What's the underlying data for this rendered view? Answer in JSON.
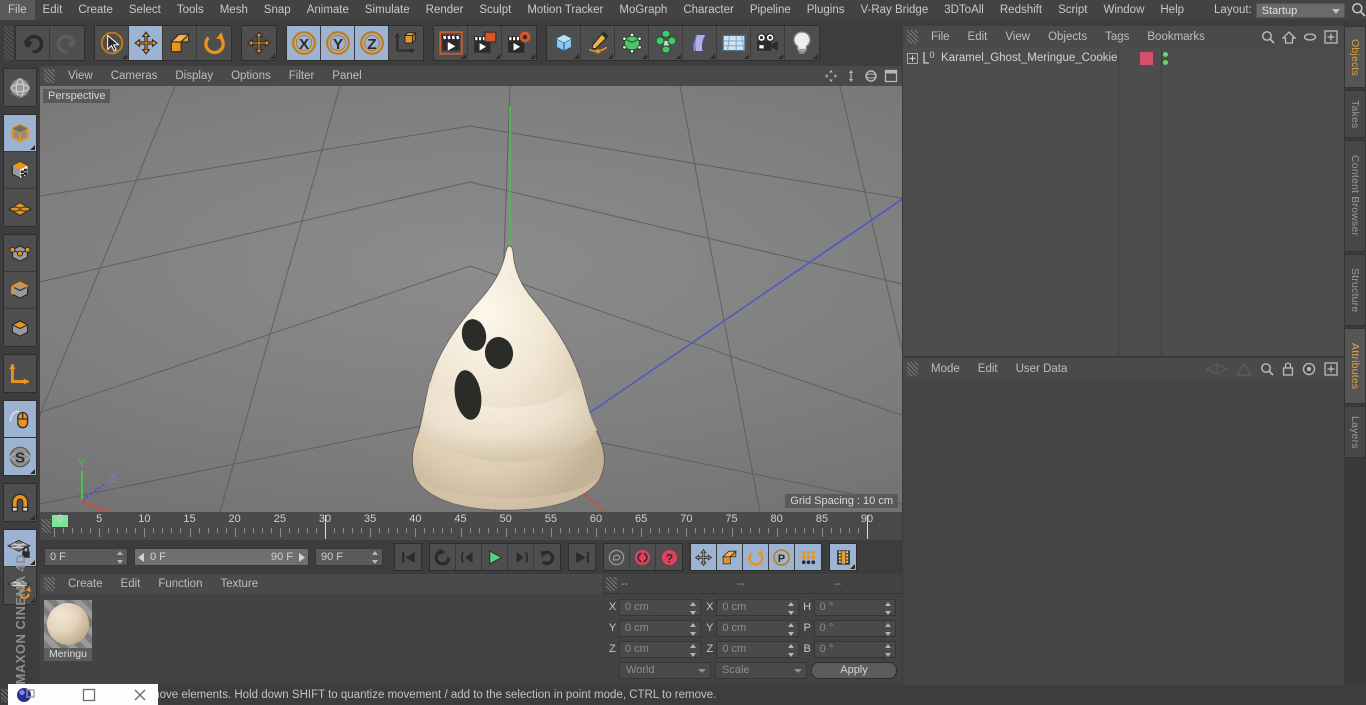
{
  "app": {
    "brand": "MAXON CINEMA 4D",
    "title": "CINEMA 4D"
  },
  "menubar": {
    "items": [
      "File",
      "Edit",
      "Create",
      "Select",
      "Tools",
      "Mesh",
      "Snap",
      "Animate",
      "Simulate",
      "Render",
      "Sculpt",
      "Motion Tracker",
      "MoGraph",
      "Character",
      "Pipeline",
      "Plugins",
      "V-Ray Bridge",
      "3DToAll",
      "Redshift",
      "Script",
      "Window",
      "Help"
    ],
    "layout_label": "Layout:",
    "layout_value": "Startup",
    "search_icon": "magnifier-icon"
  },
  "toolbar": {
    "groups": [
      {
        "name": "undo-redo",
        "buttons": [
          {
            "name": "undo-button",
            "icon": "undo-arrow-icon",
            "active": false,
            "enabled": true
          },
          {
            "name": "redo-button",
            "icon": "redo-arrow-icon",
            "active": false,
            "enabled": false
          }
        ]
      },
      {
        "name": "transform-tools",
        "buttons": [
          {
            "name": "live-selection-tool",
            "icon": "cursor-circle-icon",
            "active": false,
            "enabled": true
          },
          {
            "name": "move-tool",
            "icon": "move-arrows-icon",
            "active": true,
            "enabled": true
          },
          {
            "name": "scale-tool",
            "icon": "scale-box-icon",
            "active": false,
            "enabled": true
          },
          {
            "name": "rotate-tool",
            "icon": "rotate-arc-icon",
            "active": false,
            "enabled": true
          }
        ]
      },
      {
        "name": "move-duplicate",
        "buttons": [
          {
            "name": "move-secondary-tool",
            "icon": "move-arrows-icon",
            "active": false,
            "enabled": true
          }
        ]
      },
      {
        "name": "axis-locks",
        "buttons": [
          {
            "name": "lock-x-axis",
            "icon": "x-axis-icon",
            "label": "X",
            "active": true,
            "enabled": true
          },
          {
            "name": "lock-y-axis",
            "icon": "y-axis-icon",
            "label": "Y",
            "active": true,
            "enabled": true
          },
          {
            "name": "lock-z-axis",
            "icon": "z-axis-icon",
            "label": "Z",
            "active": true,
            "enabled": true
          },
          {
            "name": "world-object-coordinate-toggle",
            "icon": "world-axis-cube-icon",
            "active": false,
            "enabled": true
          }
        ]
      },
      {
        "name": "render-tools",
        "buttons": [
          {
            "name": "render-view-button",
            "icon": "clapperboard-icon",
            "active": false,
            "enabled": true
          },
          {
            "name": "render-to-picture-viewer-button",
            "icon": "clapperboard-window-icon",
            "active": false,
            "enabled": true
          },
          {
            "name": "render-settings-button",
            "icon": "clapperboard-gear-icon",
            "active": false,
            "enabled": true
          }
        ]
      },
      {
        "name": "object-creation",
        "buttons": [
          {
            "name": "add-primitive-cube-button",
            "icon": "blue-cube-icon",
            "active": false,
            "enabled": true
          },
          {
            "name": "add-spline-button",
            "icon": "pen-spline-icon",
            "active": false,
            "enabled": true
          },
          {
            "name": "add-generator-button",
            "icon": "green-cube-nurbs-icon",
            "active": false,
            "enabled": true
          },
          {
            "name": "add-mograph-button",
            "icon": "green-cluster-icon",
            "active": false,
            "enabled": true
          },
          {
            "name": "add-deformer-button",
            "icon": "purple-bend-icon",
            "active": false,
            "enabled": true
          },
          {
            "name": "add-scene-object-button",
            "icon": "floor-grid-icon",
            "active": false,
            "enabled": true
          },
          {
            "name": "add-camera-button",
            "icon": "camera-icon",
            "active": false,
            "enabled": true
          },
          {
            "name": "add-light-button",
            "icon": "lightbulb-icon",
            "active": false,
            "enabled": true
          }
        ]
      }
    ]
  },
  "left_toolbar": {
    "groups": [
      {
        "name": "undo-view-group",
        "buttons": [
          {
            "name": "undo-view-button",
            "icon": "globe-sphere-icon",
            "active": false
          }
        ]
      },
      {
        "name": "editor-modes-group",
        "buttons": [
          {
            "name": "make-editable-button",
            "icon": "orange-outline-cube-icon",
            "active": true
          },
          {
            "name": "texture-mode-button",
            "icon": "checker-cube-icon",
            "active": false
          },
          {
            "name": "viewport-solo-button",
            "icon": "orange-grid-plane-icon",
            "active": false
          }
        ]
      },
      {
        "name": "component-modes-group",
        "buttons": [
          {
            "name": "points-mode-button",
            "icon": "cube-points-icon",
            "active": false
          },
          {
            "name": "edges-mode-button",
            "icon": "cube-edges-icon",
            "active": false
          },
          {
            "name": "polygons-mode-button",
            "icon": "cube-polygons-icon",
            "active": false
          }
        ]
      },
      {
        "name": "axis-group",
        "buttons": [
          {
            "name": "enable-axis-modification-button",
            "icon": "axis-corner-icon",
            "active": false
          }
        ]
      },
      {
        "name": "tweak-group",
        "buttons": [
          {
            "name": "tweak-mode-button",
            "icon": "mouse-cursor-icon",
            "active": true
          },
          {
            "name": "soft-selection-button",
            "icon": "s-sphere-icon",
            "active": true
          }
        ]
      },
      {
        "name": "snap-group",
        "buttons": [
          {
            "name": "enable-snapping-button",
            "icon": "magnet-icon",
            "active": false
          }
        ]
      },
      {
        "name": "workplane-group",
        "buttons": [
          {
            "name": "lock-workplane-button",
            "icon": "grid-lock-icon",
            "active": true
          },
          {
            "name": "planar-workplane-button",
            "icon": "grid-rotate-icon",
            "active": false
          }
        ]
      }
    ]
  },
  "viewport": {
    "menu_items": [
      "View",
      "Cameras",
      "Display",
      "Options",
      "Filter",
      "Panel"
    ],
    "label": "Perspective",
    "grid_spacing": "Grid Spacing : 10 cm",
    "axis_gizmo": {
      "x": "X",
      "y": "Y",
      "z": "Z"
    },
    "header_icons": [
      "pan-move-icon",
      "zoom-dolly-icon",
      "rotate-orbit-icon",
      "maximize-view-icon"
    ],
    "scene_object": "Karamel_Ghost_Meringue_Cookie"
  },
  "timeline": {
    "ticks": [
      0,
      5,
      10,
      15,
      20,
      25,
      30,
      35,
      40,
      45,
      50,
      55,
      60,
      65,
      70,
      75,
      80,
      85,
      90
    ],
    "current_frame": 0,
    "marker_frames": [
      30,
      90
    ]
  },
  "transport": {
    "current_frame_field": "0 F",
    "range_start": "0 F",
    "range_end": "90 F",
    "end_frame_field": "90 F",
    "frame_field_right": "0 F",
    "buttons": [
      {
        "name": "go-to-start-button",
        "icon": "skip-start-icon"
      },
      {
        "name": "play-backwards-button",
        "icon": "rewind-loop-icon"
      },
      {
        "name": "step-back-button",
        "icon": "step-back-icon"
      },
      {
        "name": "play-forward-button",
        "icon": "play-triangle-icon"
      },
      {
        "name": "step-forward-button",
        "icon": "step-forward-icon"
      },
      {
        "name": "loop-playback-button",
        "icon": "loop-arrow-icon"
      },
      {
        "name": "go-to-end-button",
        "icon": "skip-end-icon"
      },
      {
        "name": "record-active-objects-button",
        "icon": "key-record-icon"
      },
      {
        "name": "autokeying-button",
        "icon": "red-circle-record-icon"
      },
      {
        "name": "keyframe-selection-button",
        "icon": "red-question-icon"
      },
      {
        "name": "position-key-button",
        "icon": "move-arrows-icon"
      },
      {
        "name": "scale-key-button",
        "icon": "scale-box-icon"
      },
      {
        "name": "rotation-key-button",
        "icon": "rotate-arc-icon"
      },
      {
        "name": "parameter-key-button",
        "icon": "p-circle-icon"
      },
      {
        "name": "point-level-animation-button",
        "icon": "dots-grid-icon"
      },
      {
        "name": "timeline-view-button",
        "icon": "filmstrip-icon"
      }
    ]
  },
  "material_manager": {
    "menu_items": [
      "Create",
      "Edit",
      "Function",
      "Texture"
    ],
    "materials": [
      {
        "name": "Meringu",
        "full_name": "Meringue",
        "color": "#e3d3bb"
      }
    ]
  },
  "coordinates": {
    "header_dashes": [
      "--",
      "--",
      "--"
    ],
    "position": {
      "label_x": "X",
      "x": "0 cm",
      "label_y": "Y",
      "y": "0 cm",
      "label_z": "Z",
      "z": "0 cm"
    },
    "size": {
      "label_x": "X",
      "x": "0 cm",
      "label_y": "Y",
      "y": "0 cm",
      "label_z": "Z",
      "z": "0 cm"
    },
    "rotation": {
      "label_h": "H",
      "h": "0 °",
      "label_p": "P",
      "p": "0 °",
      "label_b": "B",
      "b": "0 °"
    },
    "coord_system": "World",
    "transform_mode": "Scale",
    "apply_label": "Apply"
  },
  "object_manager": {
    "menu_items": [
      "File",
      "Edit",
      "View",
      "Objects",
      "Tags",
      "Bookmarks"
    ],
    "header_icons": [
      "search-icon",
      "home-icon",
      "ellipse-icon",
      "plus-box-icon"
    ],
    "objects": [
      {
        "name": "Karamel_Ghost_Meringue_Cookie",
        "expand_icon": "plus-expand-icon",
        "layer_icon": "polygon-object-icon",
        "tag_color": "#d6506a",
        "selected": false
      }
    ]
  },
  "attribute_manager": {
    "menu_items": [
      "Mode",
      "Edit",
      "User Data"
    ],
    "header_icons": [
      "animate-left-icon",
      "animate-right-icon",
      "search-icon",
      "lock-icon",
      "target-icon",
      "plus-box-icon"
    ]
  },
  "right_tabs": [
    {
      "label": "Objects",
      "active": true
    },
    {
      "label": "Takes",
      "active": false
    },
    {
      "label": "Content Browser",
      "active": false
    },
    {
      "label": "Structure",
      "active": false
    },
    {
      "label": "Attributes",
      "active": true
    },
    {
      "label": "Layers",
      "active": false
    }
  ],
  "statusbar": {
    "text": "move elements. Hold down SHIFT to quantize movement / add to the selection in point mode, CTRL to remove.",
    "window_controls": [
      {
        "name": "app-icon",
        "icon": "blue-sphere-icon"
      },
      {
        "name": "minimize-button",
        "icon": "minimize-icon"
      },
      {
        "name": "maximize-button",
        "icon": "square-icon"
      },
      {
        "name": "close-button",
        "icon": "close-x-icon"
      }
    ]
  },
  "colors": {
    "accent_orange": "#e0a43c",
    "active_blue": "#9cb3d1",
    "panel_bg": "#434343",
    "toolbar_bg": "#3d3d3d",
    "material_tag": "#d6506a",
    "axis_x": "#d04a3c",
    "axis_y": "#4fbd4f",
    "axis_z": "#4a58c8",
    "playhead_green": "#7fe39b",
    "model_cream": "#ece0cd"
  }
}
